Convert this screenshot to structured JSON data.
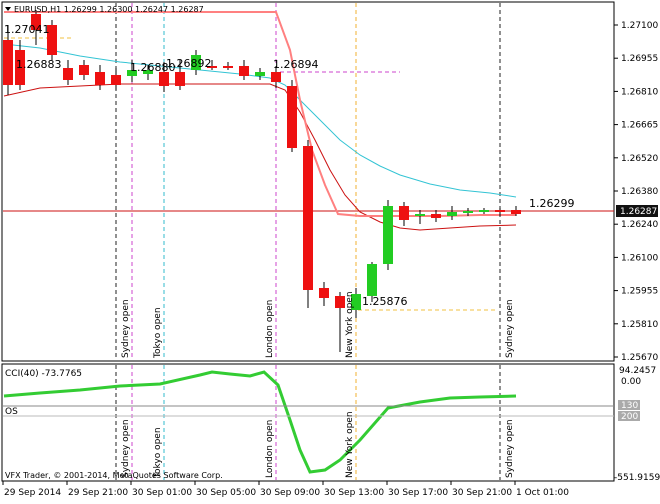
{
  "symbol_info": "EURUSD,H1  1.26299 1.26300 1.26247 1.26287",
  "copyright": "VFX Trader, © 2001-2014, MetaQuotes Software Corp.",
  "main_price_labels": [
    "1.27100",
    "1.26955",
    "1.26810",
    "1.26665",
    "1.26520",
    "1.26380",
    "1.26240",
    "1.26100",
    "1.25955",
    "1.25810",
    "1.25670"
  ],
  "current_price_tag": "1.26287",
  "price_annotations": [
    {
      "text": "1.27041"
    },
    {
      "text": "1.26883"
    },
    {
      "text": "1.26880"
    },
    {
      "text": "1.26892"
    },
    {
      "text": "1.26894"
    },
    {
      "text": "1.26299"
    },
    {
      "text": "1.25876"
    }
  ],
  "session_labels_main": [
    "Sydney open",
    "Tokyo open",
    "London open",
    "New York open",
    "Sydney open"
  ],
  "session_labels_sub": [
    "Sydney open",
    "Tokyo open",
    "London open",
    "New York open",
    "Sydney open"
  ],
  "subwindow": {
    "cci_title": "CCI(40) -73.7765",
    "os_label": "OS",
    "scale_labels": [
      "94.2457",
      "0.00",
      "130",
      "200",
      "-551.9159"
    ]
  },
  "time_axis": [
    "29 Sep 2014",
    "29 Sep 21:00",
    "30 Sep 01:00",
    "30 Sep 05:00",
    "30 Sep 09:00",
    "30 Sep 13:00",
    "30 Sep 17:00",
    "30 Sep 21:00",
    "1 Oct 01:00"
  ],
  "colors": {
    "bull": "#22cc22",
    "bear": "#ee1111",
    "fast_ma": "#ff8080",
    "slow_ma": "#cc1111",
    "cyan_ma": "#33c4d4",
    "cci": "#33cc33",
    "session_sydney": "#222222",
    "session_tokyo": "#33bbcc",
    "session_london": "#cc44cc",
    "session_newyork": "#f0b030"
  },
  "icons": {
    "symbol_arrow": "down-triangle-icon"
  }
}
